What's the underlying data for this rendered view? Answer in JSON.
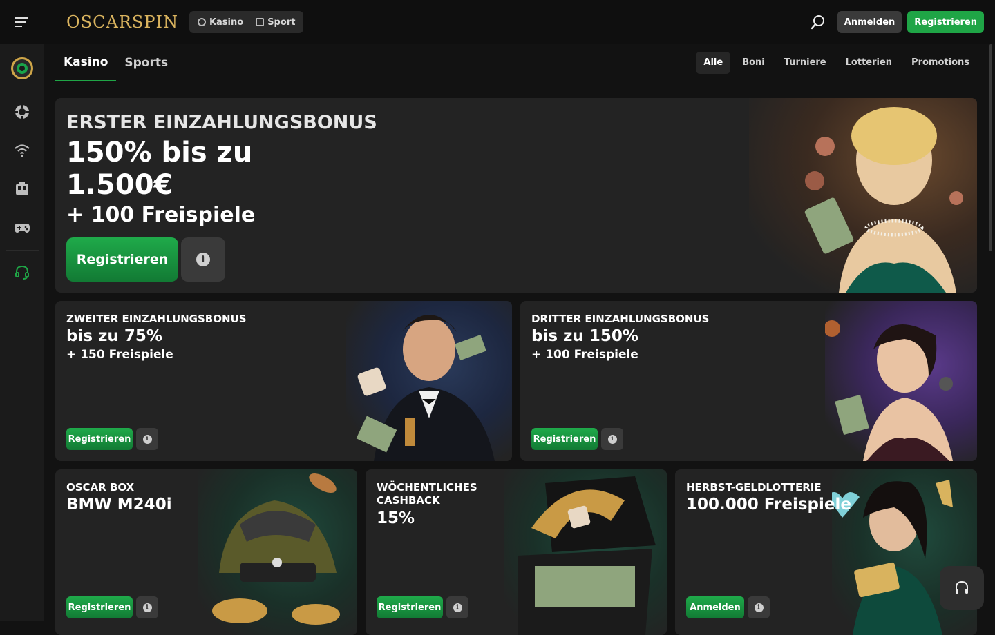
{
  "header": {
    "logo": "OSCARSPIN",
    "nav": [
      {
        "label": "Kasino"
      },
      {
        "label": "Sport"
      }
    ],
    "login_label": "Anmelden",
    "register_label": "Registrieren"
  },
  "tabs": [
    {
      "label": "Kasino"
    },
    {
      "label": "Sports"
    }
  ],
  "filters": [
    {
      "label": "Alle"
    },
    {
      "label": "Boni"
    },
    {
      "label": "Turniere"
    },
    {
      "label": "Lotterien"
    },
    {
      "label": "Promotions"
    }
  ],
  "hero": {
    "kicker": "ERSTER EINZAHLUNGSBONUS",
    "line1": "150% bis zu",
    "line2": "1.500€",
    "line3": "+ 100 Freispiele",
    "button": "Registrieren"
  },
  "cards_mid": [
    {
      "kicker": "ZWEITER EINZAHLUNGSBONUS",
      "head": "bis zu 75%",
      "sub": "+ 150 Freispiele",
      "button": "Registrieren"
    },
    {
      "kicker": "DRITTER EINZAHLUNGSBONUS",
      "head": "bis zu 150%",
      "sub": "+ 100 Freispiele",
      "button": "Registrieren"
    }
  ],
  "cards_bottom": [
    {
      "kicker": "OSCAR BOX",
      "kicker2": "",
      "head": "BMW M240i",
      "button": "Registrieren"
    },
    {
      "kicker": "WÖCHENTLICHES",
      "kicker2": "CASHBACK",
      "head": "15%",
      "button": "Registrieren"
    },
    {
      "kicker": "HERBST-GELDLOTTERIE",
      "kicker2": "",
      "head": "100.000 Freispiele",
      "button": "Anmelden"
    }
  ],
  "colors": {
    "brand_green": "#1fa546",
    "gold": "#d9b35e",
    "background": "#121212",
    "card": "#232323"
  },
  "icons": {
    "sidebar": [
      "oscar-logo-icon",
      "casino-chip-icon",
      "live-wifi-icon",
      "slot-machine-icon",
      "gamepad-icon",
      "support-headset-icon"
    ]
  }
}
